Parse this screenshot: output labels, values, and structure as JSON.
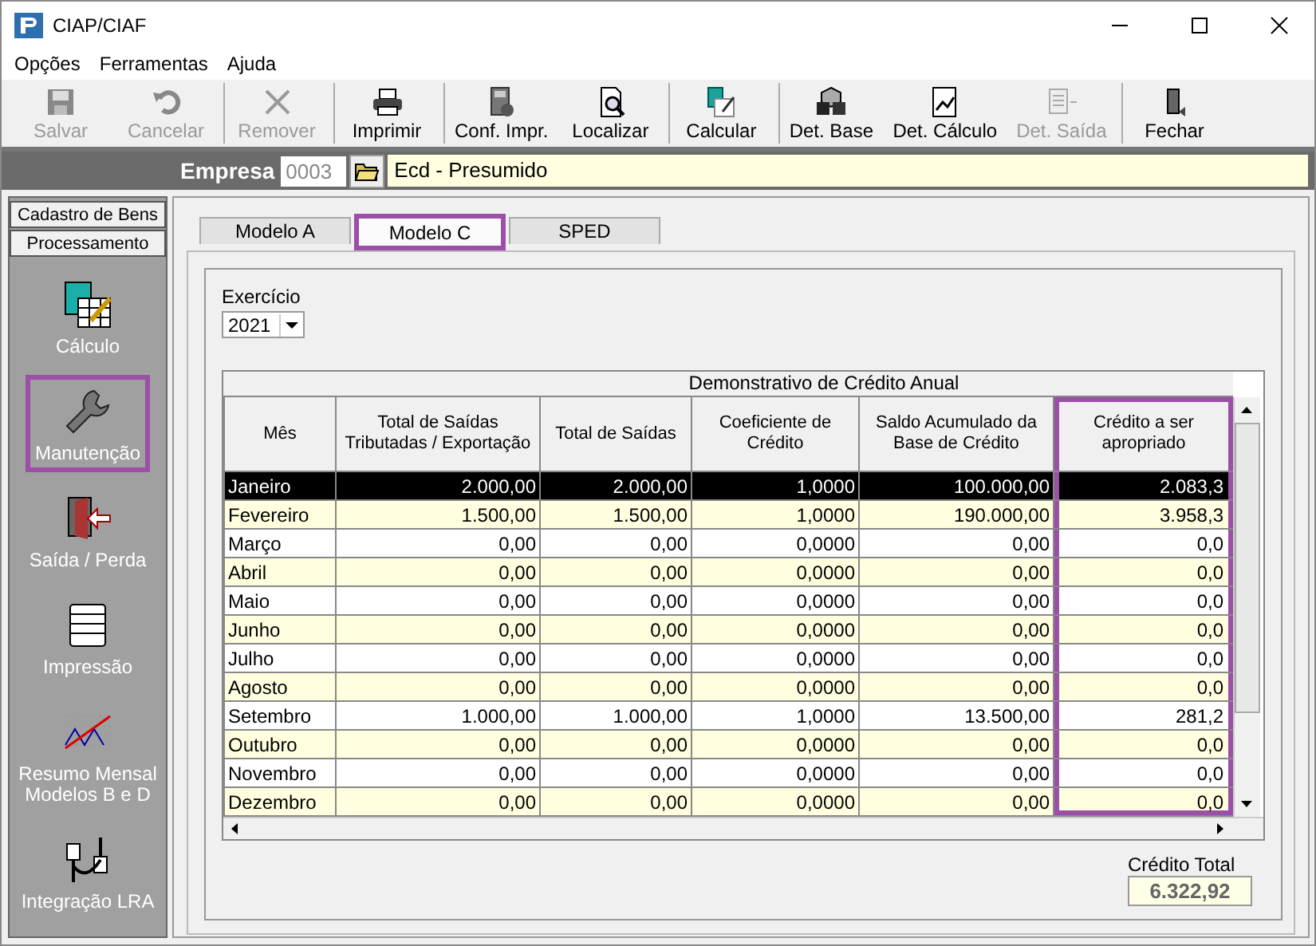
{
  "window": {
    "title": "CIAP/CIAF"
  },
  "menu": [
    "Opções",
    "Ferramentas",
    "Ajuda"
  ],
  "toolbar": [
    {
      "label": "Salvar",
      "disabled": true,
      "separator_before": false
    },
    {
      "label": "Cancelar",
      "disabled": true,
      "separator_before": false
    },
    {
      "label": "Remover",
      "disabled": true,
      "separator_before": true
    },
    {
      "label": "Imprimir",
      "disabled": false,
      "separator_before": true
    },
    {
      "label": "Conf. Impr.",
      "disabled": false,
      "separator_before": true
    },
    {
      "label": "Localizar",
      "disabled": false,
      "separator_before": false
    },
    {
      "label": "Calcular",
      "disabled": false,
      "separator_before": true
    },
    {
      "label": "Det. Base",
      "disabled": false,
      "separator_before": true
    },
    {
      "label": "Det. Cálculo",
      "disabled": false,
      "separator_before": false
    },
    {
      "label": "Det. Saída",
      "disabled": true,
      "separator_before": false
    },
    {
      "label": "Fechar",
      "disabled": false,
      "separator_before": true
    }
  ],
  "company": {
    "label": "Empresa",
    "code": "0003",
    "name": "Ecd - Presumido"
  },
  "sidebar": {
    "sections": [
      "Cadastro de Bens",
      "Processamento"
    ],
    "items": [
      {
        "label": "Cálculo",
        "highlighted": false
      },
      {
        "label": "Manutenção",
        "highlighted": true
      },
      {
        "label": "Saída / Perda",
        "highlighted": false
      },
      {
        "label": "Impressão",
        "highlighted": false
      },
      {
        "label": "Resumo Mensal\nModelos B e D",
        "highlighted": false
      },
      {
        "label": "Integração LRA",
        "highlighted": false
      }
    ]
  },
  "tabs": [
    {
      "label": "Modelo A",
      "selected": false,
      "highlighted": false
    },
    {
      "label": "Modelo C",
      "selected": true,
      "highlighted": true
    },
    {
      "label": "SPED",
      "selected": false,
      "highlighted": false
    }
  ],
  "year": {
    "label": "Exercício",
    "value": "2021"
  },
  "table": {
    "title": "Demonstrativo de Crédito Anual",
    "columns": [
      {
        "label": "Mês",
        "highlighted": false
      },
      {
        "label": "Total de Saídas Tributadas / Exportação",
        "highlighted": false
      },
      {
        "label": "Total de Saídas",
        "highlighted": false
      },
      {
        "label": "Coeficiente de Crédito",
        "highlighted": false
      },
      {
        "label": "Saldo Acumulado da Base de Crédito",
        "highlighted": false
      },
      {
        "label": "Crédito a ser apropriado",
        "highlighted": true
      }
    ],
    "rows": [
      {
        "selected": true,
        "cells": [
          "Janeiro",
          "2.000,00",
          "2.000,00",
          "1,0000",
          "100.000,00",
          "2.083,3"
        ]
      },
      {
        "selected": false,
        "cells": [
          "Fevereiro",
          "1.500,00",
          "1.500,00",
          "1,0000",
          "190.000,00",
          "3.958,3"
        ]
      },
      {
        "selected": false,
        "cells": [
          "Março",
          "0,00",
          "0,00",
          "0,0000",
          "0,00",
          "0,0"
        ]
      },
      {
        "selected": false,
        "cells": [
          "Abril",
          "0,00",
          "0,00",
          "0,0000",
          "0,00",
          "0,0"
        ]
      },
      {
        "selected": false,
        "cells": [
          "Maio",
          "0,00",
          "0,00",
          "0,0000",
          "0,00",
          "0,0"
        ]
      },
      {
        "selected": false,
        "cells": [
          "Junho",
          "0,00",
          "0,00",
          "0,0000",
          "0,00",
          "0,0"
        ]
      },
      {
        "selected": false,
        "cells": [
          "Julho",
          "0,00",
          "0,00",
          "0,0000",
          "0,00",
          "0,0"
        ]
      },
      {
        "selected": false,
        "cells": [
          "Agosto",
          "0,00",
          "0,00",
          "0,0000",
          "0,00",
          "0,0"
        ]
      },
      {
        "selected": false,
        "cells": [
          "Setembro",
          "1.000,00",
          "1.000,00",
          "1,0000",
          "13.500,00",
          "281,2"
        ]
      },
      {
        "selected": false,
        "cells": [
          "Outubro",
          "0,00",
          "0,00",
          "0,0000",
          "0,00",
          "0,0"
        ]
      },
      {
        "selected": false,
        "cells": [
          "Novembro",
          "0,00",
          "0,00",
          "0,0000",
          "0,00",
          "0,0"
        ]
      },
      {
        "selected": false,
        "cells": [
          "Dezembro",
          "0,00",
          "0,00",
          "0,0000",
          "0,00",
          "0,0"
        ]
      }
    ]
  },
  "total": {
    "label": "Crédito Total",
    "value": "6.322,92"
  }
}
